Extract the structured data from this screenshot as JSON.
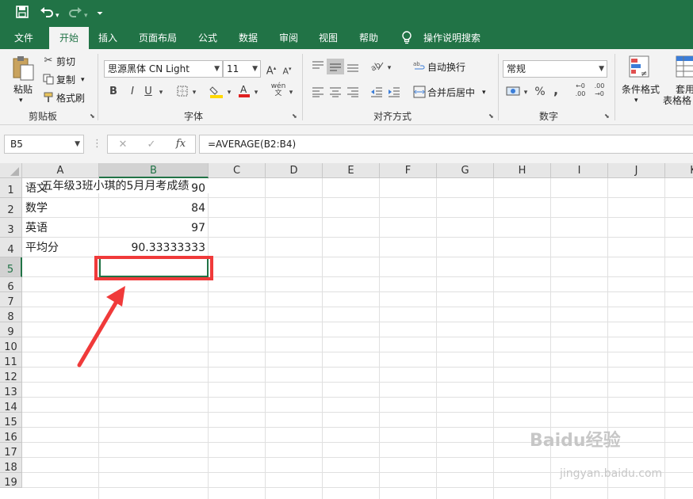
{
  "qat": {
    "save_icon": "save-icon",
    "undo_icon": "undo-icon",
    "redo_icon": "redo-icon",
    "customize_icon": "chevron-down-icon"
  },
  "tabs": [
    {
      "label": "文件"
    },
    {
      "label": "开始"
    },
    {
      "label": "插入"
    },
    {
      "label": "页面布局"
    },
    {
      "label": "公式"
    },
    {
      "label": "数据"
    },
    {
      "label": "审阅"
    },
    {
      "label": "视图"
    },
    {
      "label": "帮助"
    },
    {
      "label": "操作说明搜索"
    }
  ],
  "ribbon": {
    "clipboard": {
      "paste": "粘贴",
      "cut": "剪切",
      "copy": "复制",
      "format_painter": "格式刷",
      "label": "剪贴板"
    },
    "font": {
      "font_name": "思源黑体 CN Light",
      "font_size": "11",
      "bold": "B",
      "italic": "I",
      "underline": "U",
      "label": "字体"
    },
    "alignment": {
      "wrap_text": "自动换行",
      "merge_center": "合并后居中",
      "label": "对齐方式"
    },
    "number": {
      "format": "常规",
      "percent": "%",
      "comma": ",",
      "label": "数字"
    },
    "styles": {
      "conditional": "条件格式",
      "table_format_1": "套用",
      "table_format_2": "表格格"
    }
  },
  "formula_bar": {
    "name_box": "B5",
    "formula": "=AVERAGE(B2:B4)",
    "fx": "fx"
  },
  "grid": {
    "columns": [
      "A",
      "B",
      "C",
      "D",
      "E",
      "F",
      "G",
      "H",
      "I",
      "J",
      "K"
    ],
    "rows": [
      "1",
      "2",
      "3",
      "4",
      "5",
      "6",
      "7",
      "8",
      "9",
      "10",
      "11",
      "12",
      "13",
      "14",
      "15",
      "16",
      "17",
      "18",
      "19"
    ],
    "cells": {
      "title": "五年级3班小琪的5月月考成绩",
      "a2": "语文",
      "b2": "90",
      "a3": "数学",
      "b3": "84",
      "a4": "英语",
      "b4": "97",
      "a5": "平均分",
      "b5": "90.33333333"
    },
    "selected_cell": "B5"
  },
  "watermark": {
    "text": "Baidu经验",
    "url": "jingyan.baidu.com"
  },
  "colors": {
    "excel_green": "#217346",
    "annotation_red": "#f03a3a"
  }
}
